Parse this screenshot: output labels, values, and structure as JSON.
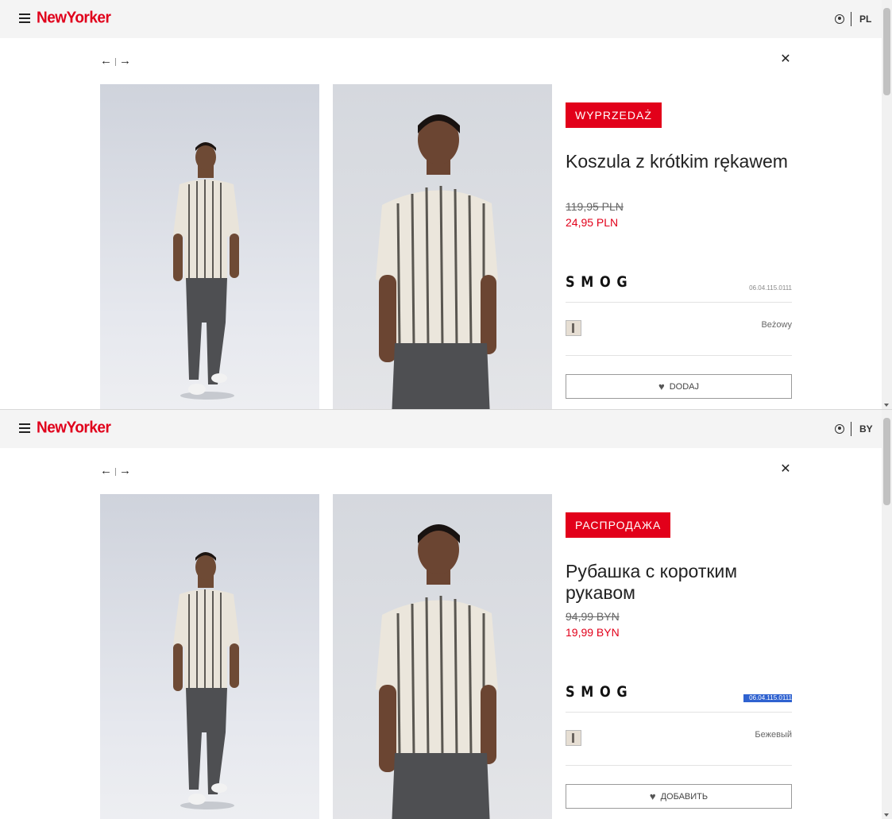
{
  "header": {
    "logo": "NewYorker"
  },
  "panes": [
    {
      "lang": "PL",
      "badge": "WYPRZEDAŻ",
      "title": "Koszula z krótkim rękawem",
      "old_price": "119,95 PLN",
      "new_price": "24,95 PLN",
      "brand": "SMOG",
      "sku": "06.04.115.0111",
      "color": "Beżowy",
      "wishlist_label": "DODAJ"
    },
    {
      "lang": "BY",
      "badge": "РАСПРОДАЖА",
      "title": "Рубашка с коротким рукавом",
      "old_price": "94,99 BYN",
      "new_price": "19,99 BYN",
      "brand": "SMOG",
      "sku": "06.04.115.0111",
      "color": "Бежевый",
      "wishlist_label": "ДОБАВИТЬ"
    }
  ],
  "colors": {
    "accent": "#e2001a",
    "header_bg": "#f4f4f4",
    "sku_selection": "#2f62d0"
  },
  "icons": {
    "menu": "hamburger-icon",
    "account": "user-icon",
    "prev": "arrow-left-icon",
    "next": "arrow-right-icon",
    "close": "close-icon",
    "wishlist": "heart-icon"
  }
}
